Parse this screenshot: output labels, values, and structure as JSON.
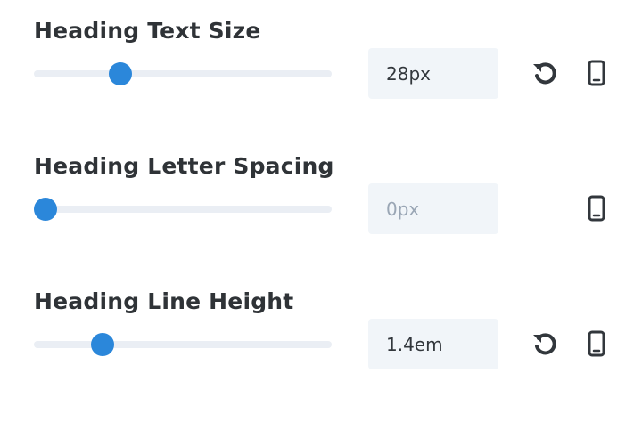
{
  "settings": [
    {
      "label": "Heading Text Size",
      "value": "28px",
      "placeholder": "",
      "slider_fraction": 0.29,
      "has_reset": true
    },
    {
      "label": "Heading Letter Spacing",
      "value": "",
      "placeholder": "0px",
      "slider_fraction": 0.04,
      "has_reset": false
    },
    {
      "label": "Heading Line Height",
      "value": "1.4em",
      "placeholder": "",
      "slider_fraction": 0.23,
      "has_reset": true
    }
  ],
  "icons": {
    "reset": "reset-arrow-icon",
    "responsive": "mobile-phone-icon"
  },
  "colors": {
    "accent": "#2b87da",
    "track": "#eaeef4",
    "input_bg": "#f1f5f9",
    "label_text": "#2f3337",
    "icon": "#32373c",
    "placeholder": "#9aa6b5"
  }
}
